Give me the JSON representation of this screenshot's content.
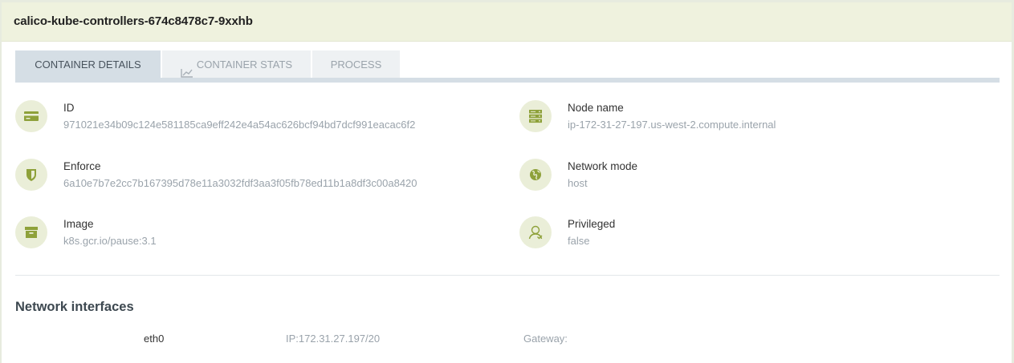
{
  "header": {
    "title": "calico-kube-controllers-674c8478c7-9xxhb"
  },
  "tabs": [
    {
      "label": "CONTAINER DETAILS",
      "active": true
    },
    {
      "label": "CONTAINER STATS",
      "icon": "line-chart-icon"
    },
    {
      "label": "PROCESS"
    }
  ],
  "details": {
    "id": {
      "label": "ID",
      "value": "971021e34b09c124e581185ca9eff242e4a54ac626bcf94bd7dcf991eacac6f2",
      "icon": "id-card-icon"
    },
    "enforce": {
      "label": "Enforce",
      "value": "6a10e7b7e2cc7b167395d78e11a3032fdf3aa3f05fb78ed11b1a8df3c00a8420",
      "icon": "shield-icon"
    },
    "image": {
      "label": "Image",
      "value": "k8s.gcr.io/pause:3.1",
      "icon": "archive-box-icon"
    },
    "node_name": {
      "label": "Node name",
      "value": "ip-172-31-27-197.us-west-2.compute.internal",
      "icon": "server-icon"
    },
    "network_mode": {
      "label": "Network mode",
      "value": "host",
      "icon": "globe-icon"
    },
    "privileged": {
      "label": "Privileged",
      "value": "false",
      "icon": "user-icon"
    }
  },
  "network": {
    "title": "Network interfaces",
    "interfaces": [
      {
        "name": "eth0",
        "ip": "IP:172.31.27.197/20",
        "gateway": "Gateway:"
      }
    ]
  },
  "colors": {
    "header_bg": "#eff2de",
    "icon_circle": "#eaeed8",
    "icon_fg": "#8ea13a",
    "tab_active": "#d5dee5",
    "muted_text": "#9aa3ab"
  }
}
